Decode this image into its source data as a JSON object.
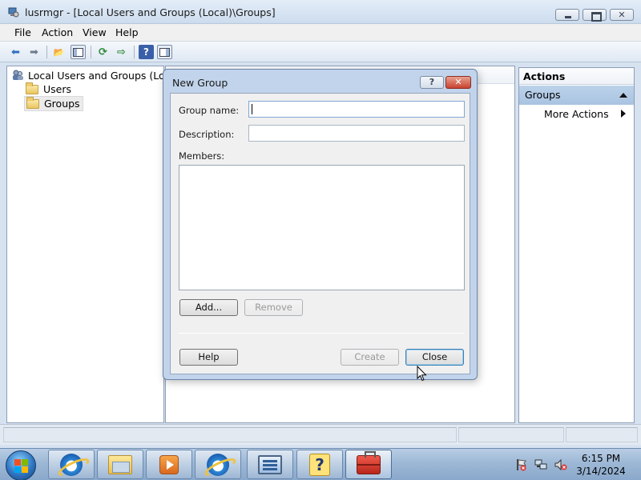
{
  "window": {
    "title": "lusrmgr - [Local Users and Groups (Local)\\Groups]",
    "close_glyph": "✕"
  },
  "menu": [
    "File",
    "Action",
    "View",
    "Help"
  ],
  "toolbar": {
    "icons": [
      "back-arrow-icon",
      "forward-arrow-icon",
      "up-folder-icon",
      "show-hide-tree-icon",
      "refresh-icon",
      "export-list-icon",
      "help-icon",
      "show-hide-action-pane-icon"
    ],
    "glyphs": {
      "back": "⬅",
      "forward": "➡",
      "up": "📂",
      "refresh": "⟳",
      "export": "⇨",
      "help": "?"
    }
  },
  "tree": {
    "root": "Local Users and Groups (Local)",
    "children": [
      {
        "label": "Users",
        "selected": false
      },
      {
        "label": "Groups",
        "selected": true
      }
    ]
  },
  "actions": {
    "title": "Actions",
    "group": "Groups",
    "items": [
      "More Actions"
    ]
  },
  "dialog": {
    "title": "New Group",
    "help_glyph": "?",
    "close_glyph": "✕",
    "group_name_label": "Group name:",
    "group_name_value": "",
    "description_label": "Description:",
    "description_value": "",
    "members_label": "Members:",
    "members": [],
    "add_button": "Add...",
    "remove_button": "Remove",
    "help_button": "Help",
    "create_button": "Create",
    "close_button": "Close"
  },
  "taskbar": {
    "apps": [
      "internet-explorer",
      "windows-explorer",
      "media-player",
      "internet-explorer",
      "remote-desktop",
      "help-and-support",
      "computer-management"
    ],
    "help_glyph": "?"
  },
  "clock": {
    "time": "6:15 PM",
    "date": "3/14/2024"
  },
  "colors": {
    "accent": "#c2d4eb",
    "selection": "#a9c3e1",
    "close_red": "#c9432f"
  }
}
